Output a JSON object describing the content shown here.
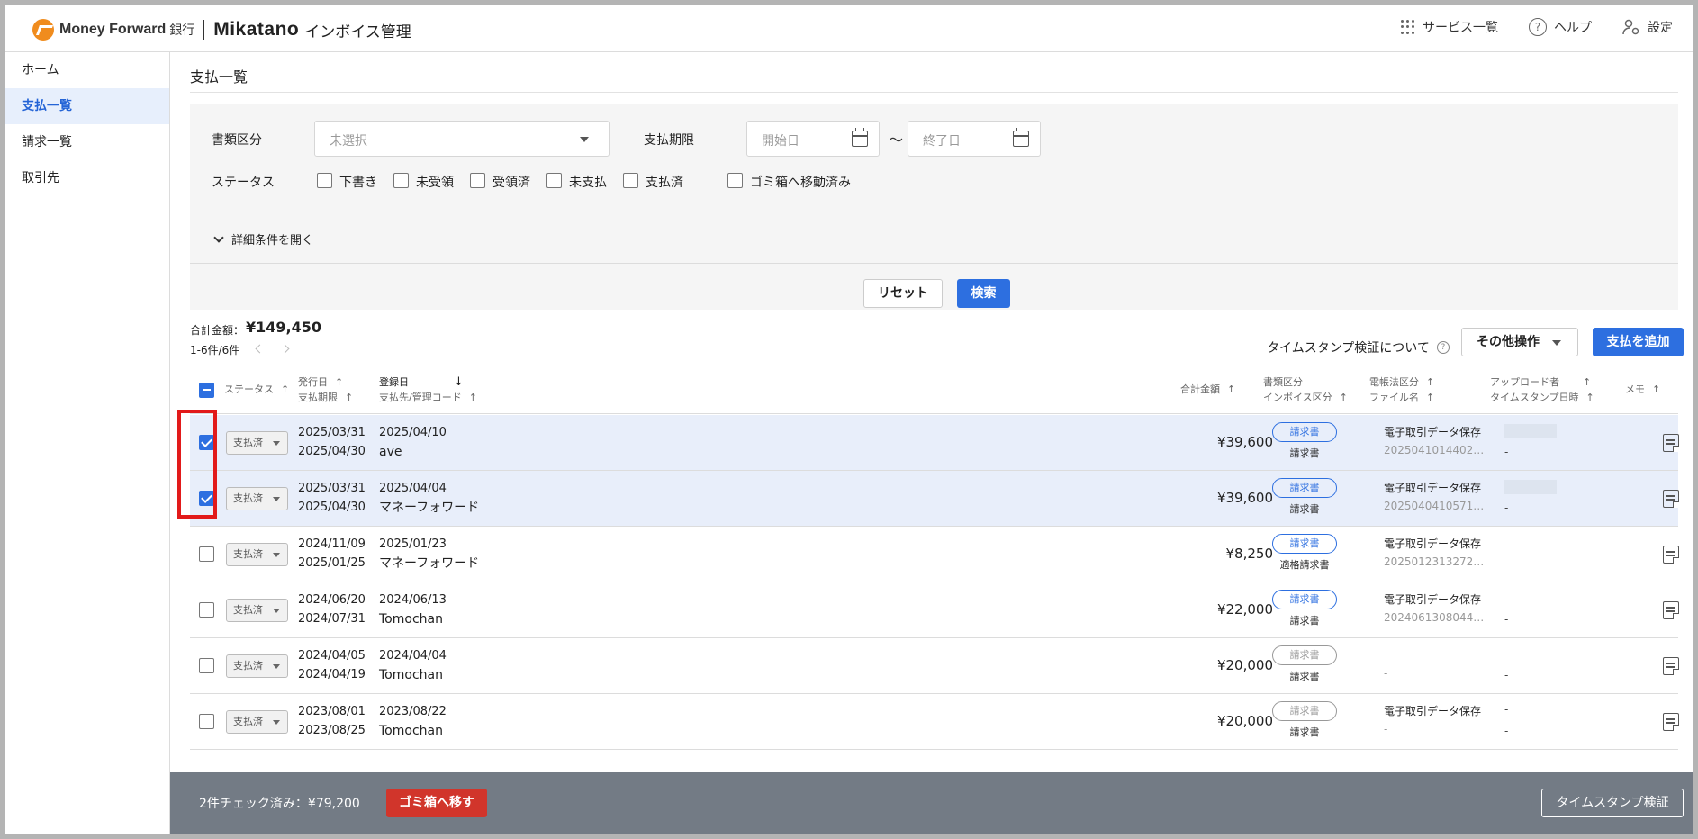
{
  "header": {
    "logo_mf": "Money Forward",
    "logo_bank": "銀行",
    "logo_mikatano": "Mikatano",
    "app_name": "インボイス管理",
    "actions": [
      {
        "label": "サービス一覧",
        "icon": "apps-grid-icon"
      },
      {
        "label": "ヘルプ",
        "icon": "help-icon"
      },
      {
        "label": "設定",
        "icon": "user-settings-icon"
      }
    ]
  },
  "sidebar": {
    "items": [
      {
        "label": "ホーム",
        "active": false
      },
      {
        "label": "支払一覧",
        "active": true
      },
      {
        "label": "請求一覧",
        "active": false
      },
      {
        "label": "取引先",
        "active": false
      }
    ]
  },
  "page": {
    "title": "支払一覧"
  },
  "filters": {
    "doc_type_label": "書類区分",
    "doc_type_placeholder": "未選択",
    "due_label": "支払期限",
    "start_placeholder": "開始日",
    "range_sep": "〜",
    "end_placeholder": "終了日",
    "status_label": "ステータス",
    "statuses": [
      "下書き",
      "未受領",
      "受領済",
      "未支払",
      "支払済",
      "ゴミ箱へ移動済み"
    ],
    "detail_toggle": "詳細条件を開く",
    "reset": "リセット",
    "search": "検索"
  },
  "summary": {
    "total_label": "合計金額：",
    "total_value": "¥149,450",
    "range": "1-6件/6件"
  },
  "toolbar": {
    "timestamp_link": "タイムスタンプ検証について",
    "other_ops": "その他操作",
    "add_payment": "支払を追加"
  },
  "table": {
    "headers": {
      "status": "ステータス",
      "issue_date": "発行日",
      "due_date": "支払期限",
      "reg_date": "登録日",
      "vendor": "支払先/管理コード",
      "amount": "合計金額",
      "doc_type": "書類区分",
      "invoice_type": "インボイス区分",
      "law_type": "電帳法区分",
      "file_name": "ファイル名",
      "uploader": "アップロード者",
      "timestamp": "タイムスタンプ日時",
      "memo": "メモ"
    },
    "rows": [
      {
        "checked": true,
        "status": "支払済",
        "issue": "2025/03/31",
        "due": "2025/04/30",
        "reg": "2025/04/10",
        "vendor": "ave",
        "amount": "¥39,600",
        "doc": "請求書",
        "doc_active": true,
        "invoice": "請求書",
        "law": "電子取引データ保存",
        "file": "2025041014402…",
        "uploader": "",
        "ts": "-"
      },
      {
        "checked": true,
        "status": "支払済",
        "issue": "2025/03/31",
        "due": "2025/04/30",
        "reg": "2025/04/04",
        "vendor": "マネーフォワード",
        "amount": "¥39,600",
        "doc": "請求書",
        "doc_active": true,
        "invoice": "請求書",
        "law": "電子取引データ保存",
        "file": "2025040410571…",
        "uploader": "",
        "ts": "-"
      },
      {
        "checked": false,
        "status": "支払済",
        "issue": "2024/11/09",
        "due": "2025/01/25",
        "reg": "2025/01/23",
        "vendor": "マネーフォワード",
        "amount": "¥8,250",
        "doc": "請求書",
        "doc_active": true,
        "invoice": "適格請求書",
        "law": "電子取引データ保存",
        "file": "2025012313272…",
        "uploader": "",
        "ts": "-"
      },
      {
        "checked": false,
        "status": "支払済",
        "issue": "2024/06/20",
        "due": "2024/07/31",
        "reg": "2024/06/13",
        "vendor": "Tomochan",
        "amount": "¥22,000",
        "doc": "請求書",
        "doc_active": true,
        "invoice": "請求書",
        "law": "電子取引データ保存",
        "file": "2024061308044…",
        "uploader": "",
        "ts": "-"
      },
      {
        "checked": false,
        "status": "支払済",
        "issue": "2024/04/05",
        "due": "2024/04/19",
        "reg": "2024/04/04",
        "vendor": "Tomochan",
        "amount": "¥20,000",
        "doc": "請求書",
        "doc_active": false,
        "invoice": "請求書",
        "law": "-",
        "file": "-",
        "uploader": "-",
        "ts": "-"
      },
      {
        "checked": false,
        "status": "支払済",
        "issue": "2023/08/01",
        "due": "2023/08/25",
        "reg": "2023/08/22",
        "vendor": "Tomochan",
        "amount": "¥20,000",
        "doc": "請求書",
        "doc_active": false,
        "invoice": "請求書",
        "law": "電子取引データ保存",
        "file": "-",
        "uploader": "-",
        "ts": "-"
      }
    ]
  },
  "footer": {
    "checked_text": "2件チェック済み：¥79,200",
    "trash_button": "ゴミ箱へ移す",
    "timestamp_button": "タイムスタンプ検証"
  },
  "colors": {
    "accent": "#2d6fe0",
    "danger": "#d1352b",
    "highlight": "#e21a1a",
    "footer_bg": "#737b85",
    "selected_row": "#e8eefa"
  }
}
